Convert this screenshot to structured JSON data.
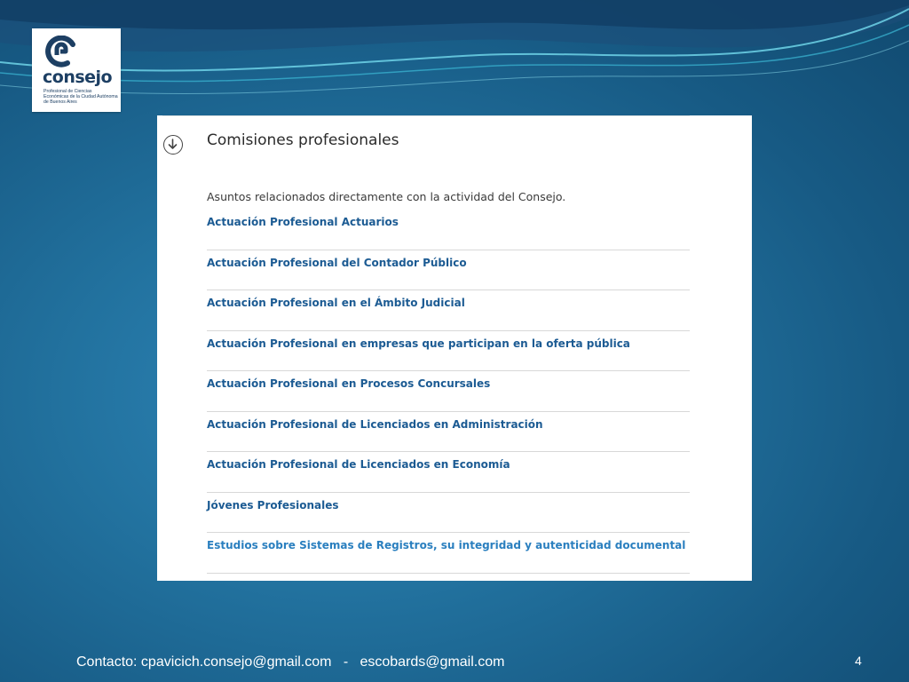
{
  "logo": {
    "word": "consejo",
    "subtitle": "Profesional de Ciencias Económicas de la Ciudad Autónoma de Buenos Aires"
  },
  "panel": {
    "icon": "arrow-down-circle-icon",
    "title": "Comisiones profesionales",
    "description": "Asuntos relacionados directamente con la actividad del Consejo.",
    "links": [
      {
        "label": "Actuación Profesional Actuarios"
      },
      {
        "label": "Actuación Profesional del Contador Público"
      },
      {
        "label": "Actuación Profesional en el Ámbito Judicial"
      },
      {
        "label": "Actuación Profesional en empresas que participan en la oferta pública"
      },
      {
        "label": "Actuación Profesional en Procesos Concursales"
      },
      {
        "label": "Actuación Profesional de Licenciados en Administración"
      },
      {
        "label": "Actuación Profesional de Licenciados en Economía"
      },
      {
        "label": "Jóvenes Profesionales"
      },
      {
        "label": "Estudios sobre Sistemas de Registros, su integridad y autenticidad documental"
      }
    ]
  },
  "footer": {
    "contact": "Contacto: cpavicich.consejo@gmail.com   -   escobards@gmail.com",
    "slide_number": "4"
  },
  "colors": {
    "background": "#22729f",
    "link": "#1c5b93",
    "link_highlight": "#2a7fbf",
    "logo_mark": "#1d3f63"
  }
}
